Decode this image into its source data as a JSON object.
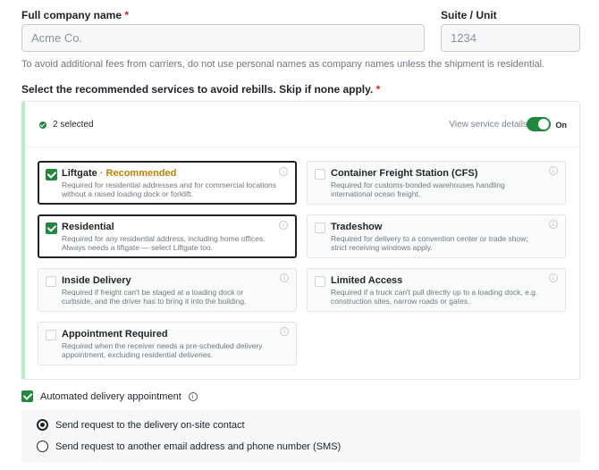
{
  "company": {
    "label": "Full company name",
    "required_mark": "*",
    "placeholder": "Acme Co."
  },
  "suite": {
    "label": "Suite / Unit",
    "placeholder": "1234"
  },
  "hint": "To avoid additional fees from carriers, do not use personal names as company names unless the shipment is residential.",
  "services": {
    "label": "Select the recommended services to avoid rebills. Skip if none apply.",
    "required_mark": "*",
    "selected_count": "2 selected",
    "view_details": "View service details",
    "toggle_label": "On",
    "toggle_on": true,
    "cards": [
      {
        "title": "Liftgate",
        "recommended": " · Recommended",
        "desc": "Required for residential addresses and for commercial locations without a raised loading dock or forklift.",
        "checked": true
      },
      {
        "title": "Container Freight Station (CFS)",
        "desc": "Required for customs-bonded warehouses handling international ocean freight.",
        "checked": false
      },
      {
        "title": "Residential",
        "desc": "Required for any residential address, including home offices. Always needs a liftgate — select Liftgate too.",
        "checked": true
      },
      {
        "title": "Tradeshow",
        "desc": "Required for delivery to a convention center or trade show; strict receiving windows apply.",
        "checked": false
      },
      {
        "title": "Inside Delivery",
        "desc": "Required if freight can't be staged at a loading dock or curbside, and the driver has to bring it into the building.",
        "checked": false
      },
      {
        "title": "Limited Access",
        "desc": "Required if a truck can't pull directly up to a loading dock, e.g. construction sites, narrow roads or gates.",
        "checked": false
      },
      {
        "title": "Appointment Required",
        "desc": "Required when the receiver needs a pre-scheduled delivery appointment, excluding residential deliveries.",
        "checked": false
      }
    ]
  },
  "automated": {
    "label": "Automated delivery appointment",
    "checked": true
  },
  "radio": {
    "options": [
      {
        "label": "Send request to the delivery on-site contact",
        "checked": true
      },
      {
        "label": "Send request to another email address and phone number (SMS)",
        "checked": false
      }
    ]
  },
  "icons": {
    "info": "info-icon",
    "check": "check-icon"
  },
  "colors": {
    "accent_green": "#1f883d",
    "required_red": "#d1242f",
    "recommended_orange": "#c17f00",
    "panel_stripe": "#b6ecc6"
  }
}
